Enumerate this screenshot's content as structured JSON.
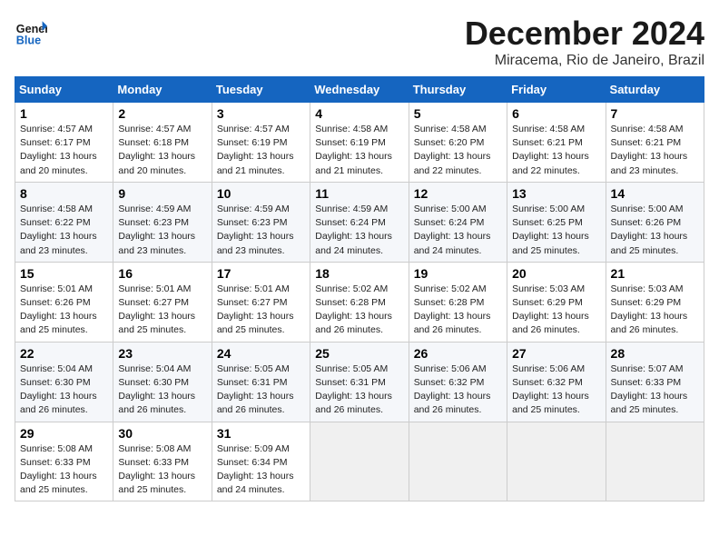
{
  "header": {
    "logo_line1": "General",
    "logo_line2": "Blue",
    "month_title": "December 2024",
    "subtitle": "Miracema, Rio de Janeiro, Brazil"
  },
  "weekdays": [
    "Sunday",
    "Monday",
    "Tuesday",
    "Wednesday",
    "Thursday",
    "Friday",
    "Saturday"
  ],
  "weeks": [
    [
      {
        "day": "1",
        "sunrise": "4:57 AM",
        "sunset": "6:17 PM",
        "daylight": "13 hours and 20 minutes."
      },
      {
        "day": "2",
        "sunrise": "4:57 AM",
        "sunset": "6:18 PM",
        "daylight": "13 hours and 20 minutes."
      },
      {
        "day": "3",
        "sunrise": "4:57 AM",
        "sunset": "6:19 PM",
        "daylight": "13 hours and 21 minutes."
      },
      {
        "day": "4",
        "sunrise": "4:58 AM",
        "sunset": "6:19 PM",
        "daylight": "13 hours and 21 minutes."
      },
      {
        "day": "5",
        "sunrise": "4:58 AM",
        "sunset": "6:20 PM",
        "daylight": "13 hours and 22 minutes."
      },
      {
        "day": "6",
        "sunrise": "4:58 AM",
        "sunset": "6:21 PM",
        "daylight": "13 hours and 22 minutes."
      },
      {
        "day": "7",
        "sunrise": "4:58 AM",
        "sunset": "6:21 PM",
        "daylight": "13 hours and 23 minutes."
      }
    ],
    [
      {
        "day": "8",
        "sunrise": "4:58 AM",
        "sunset": "6:22 PM",
        "daylight": "13 hours and 23 minutes."
      },
      {
        "day": "9",
        "sunrise": "4:59 AM",
        "sunset": "6:23 PM",
        "daylight": "13 hours and 23 minutes."
      },
      {
        "day": "10",
        "sunrise": "4:59 AM",
        "sunset": "6:23 PM",
        "daylight": "13 hours and 23 minutes."
      },
      {
        "day": "11",
        "sunrise": "4:59 AM",
        "sunset": "6:24 PM",
        "daylight": "13 hours and 24 minutes."
      },
      {
        "day": "12",
        "sunrise": "5:00 AM",
        "sunset": "6:24 PM",
        "daylight": "13 hours and 24 minutes."
      },
      {
        "day": "13",
        "sunrise": "5:00 AM",
        "sunset": "6:25 PM",
        "daylight": "13 hours and 25 minutes."
      },
      {
        "day": "14",
        "sunrise": "5:00 AM",
        "sunset": "6:26 PM",
        "daylight": "13 hours and 25 minutes."
      }
    ],
    [
      {
        "day": "15",
        "sunrise": "5:01 AM",
        "sunset": "6:26 PM",
        "daylight": "13 hours and 25 minutes."
      },
      {
        "day": "16",
        "sunrise": "5:01 AM",
        "sunset": "6:27 PM",
        "daylight": "13 hours and 25 minutes."
      },
      {
        "day": "17",
        "sunrise": "5:01 AM",
        "sunset": "6:27 PM",
        "daylight": "13 hours and 25 minutes."
      },
      {
        "day": "18",
        "sunrise": "5:02 AM",
        "sunset": "6:28 PM",
        "daylight": "13 hours and 26 minutes."
      },
      {
        "day": "19",
        "sunrise": "5:02 AM",
        "sunset": "6:28 PM",
        "daylight": "13 hours and 26 minutes."
      },
      {
        "day": "20",
        "sunrise": "5:03 AM",
        "sunset": "6:29 PM",
        "daylight": "13 hours and 26 minutes."
      },
      {
        "day": "21",
        "sunrise": "5:03 AM",
        "sunset": "6:29 PM",
        "daylight": "13 hours and 26 minutes."
      }
    ],
    [
      {
        "day": "22",
        "sunrise": "5:04 AM",
        "sunset": "6:30 PM",
        "daylight": "13 hours and 26 minutes."
      },
      {
        "day": "23",
        "sunrise": "5:04 AM",
        "sunset": "6:30 PM",
        "daylight": "13 hours and 26 minutes."
      },
      {
        "day": "24",
        "sunrise": "5:05 AM",
        "sunset": "6:31 PM",
        "daylight": "13 hours and 26 minutes."
      },
      {
        "day": "25",
        "sunrise": "5:05 AM",
        "sunset": "6:31 PM",
        "daylight": "13 hours and 26 minutes."
      },
      {
        "day": "26",
        "sunrise": "5:06 AM",
        "sunset": "6:32 PM",
        "daylight": "13 hours and 26 minutes."
      },
      {
        "day": "27",
        "sunrise": "5:06 AM",
        "sunset": "6:32 PM",
        "daylight": "13 hours and 25 minutes."
      },
      {
        "day": "28",
        "sunrise": "5:07 AM",
        "sunset": "6:33 PM",
        "daylight": "13 hours and 25 minutes."
      }
    ],
    [
      {
        "day": "29",
        "sunrise": "5:08 AM",
        "sunset": "6:33 PM",
        "daylight": "13 hours and 25 minutes."
      },
      {
        "day": "30",
        "sunrise": "5:08 AM",
        "sunset": "6:33 PM",
        "daylight": "13 hours and 25 minutes."
      },
      {
        "day": "31",
        "sunrise": "5:09 AM",
        "sunset": "6:34 PM",
        "daylight": "13 hours and 24 minutes."
      },
      null,
      null,
      null,
      null
    ]
  ]
}
